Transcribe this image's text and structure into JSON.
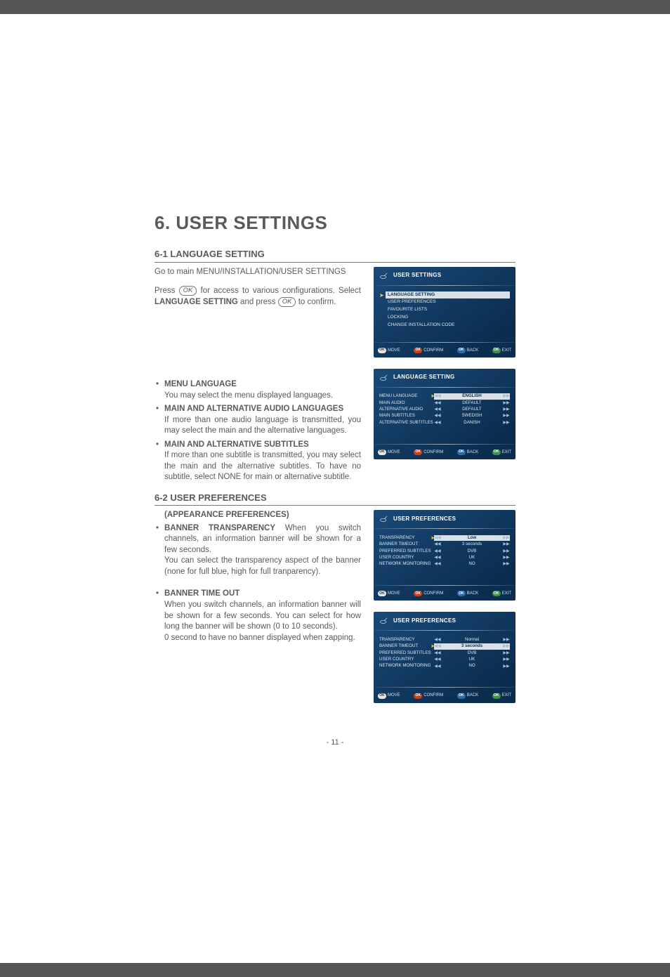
{
  "title": "6. USER SETTINGS",
  "s61": {
    "heading": "6-1 LANGUAGE SETTING",
    "intro1": "Go to main MENU/INSTALLATION/USER SETTINGS",
    "intro2a": "Press ",
    "intro2b": " for access to various configurations. Select ",
    "intro2c": " and press ",
    "intro2d": " to confirm.",
    "lang_setting_bold": "LANGUAGE SETTING",
    "ok_label": "OK",
    "b1_head": "MENU LANGUAGE",
    "b1_body": "You may select the menu displayed languages.",
    "b2_head": "MAIN AND ALTERNATIVE AUDIO LANGUAGES",
    "b2_body": "If more than one audio language is transmitted, you may select the main and the alternative languages.",
    "b3_head": "MAIN AND ALTERNATIVE SUBTITLES",
    "b3_body": "If more than one subtitle is transmitted, you may select the main and the alternative subtitles. To have no subtitle, select NONE for main or alternative subtitle."
  },
  "s62": {
    "heading": "6-2 USER PREFERENCES",
    "subhead": "(APPEARANCE PREFERENCES)",
    "b1_head": "BANNER TRANSPARENCY",
    "b1_body1": " When you switch channels, an information banner will be shown for a few seconds.",
    "b1_body2": "You can select the transparency aspect of the banner (none for full blue, high for full tranparency).",
    "b2_head": "BANNER TIME OUT",
    "b2_body1": "When you switch channels, an information banner will be shown for a few seconds. You can select for how long the banner will be shown (0 to 10 seconds).",
    "b2_body2": "0 second to have no banner displayed when zapping."
  },
  "osd_common": {
    "move": "MOVE",
    "confirm": "CONFIRM",
    "back": "BACK",
    "exit": "EXIT",
    "ok": "OK"
  },
  "osd1": {
    "title": "USER SETTINGS",
    "items": [
      "LANGUAGE SETTING",
      "USER PREFERENCES",
      "FAVOURITE LISTS",
      "LOCKING",
      "CHANGE INSTALLATION CODE"
    ]
  },
  "osd2": {
    "title": "LANGUAGE SETTING",
    "rows": [
      {
        "label": "MENU LANGUAGE",
        "value": "ENGLISH",
        "sel": true
      },
      {
        "label": "MAIN AUDIO",
        "value": "DEFAULT",
        "sel": false
      },
      {
        "label": "ALTERNATIVE AUDIO",
        "value": "DEFAULT",
        "sel": false
      },
      {
        "label": "MAIN SUBTITLES",
        "value": "SWEDISH",
        "sel": false
      },
      {
        "label": "ALTERNATIVE SUBTITLES",
        "value": "DANISH",
        "sel": false
      }
    ]
  },
  "osd3": {
    "title": "USER PREFERENCES",
    "rows": [
      {
        "label": "TRANSPARENCY",
        "value": "Low",
        "sel": true
      },
      {
        "label": "BANNER TIMEOUT",
        "value": "3 seconds",
        "sel": false
      },
      {
        "label": "PREFERRED SUBTITLES",
        "value": "DVB",
        "sel": false
      },
      {
        "label": "USER COUNTRY",
        "value": "UK",
        "sel": false
      },
      {
        "label": "NETWORK MONITORING",
        "value": "NO",
        "sel": false
      }
    ]
  },
  "osd4": {
    "title": "USER PREFERENCES",
    "rows": [
      {
        "label": "TRANSPARENCY",
        "value": "Normal",
        "sel": false
      },
      {
        "label": "BANNER TIMEOUT",
        "value": "3 seconds",
        "sel": true
      },
      {
        "label": "PREFERRED SUBTITLES",
        "value": "DVB",
        "sel": false
      },
      {
        "label": "USER COUNTRY",
        "value": "UK",
        "sel": false
      },
      {
        "label": "NETWORK MONITORING",
        "value": "NO",
        "sel": false
      }
    ]
  },
  "page_num": "- 11 -"
}
